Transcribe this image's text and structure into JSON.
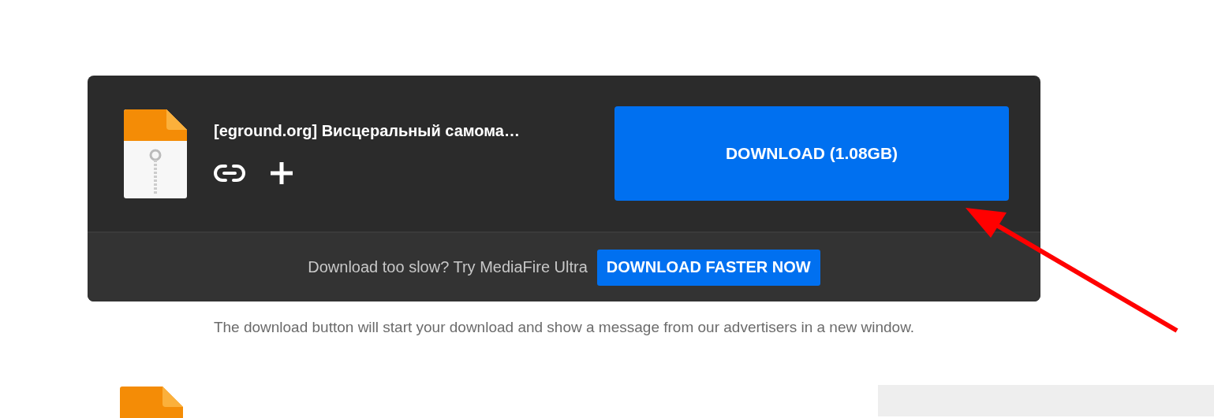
{
  "file": {
    "name": "[eground.org] Висцеральный самома…"
  },
  "download_button": {
    "label": "DOWNLOAD (1.08GB)"
  },
  "upsell": {
    "text": "Download too slow? Try MediaFire Ultra",
    "button": "DOWNLOAD FASTER NOW"
  },
  "notice": "The download button will start your download and show a message from our advertisers in a new window."
}
